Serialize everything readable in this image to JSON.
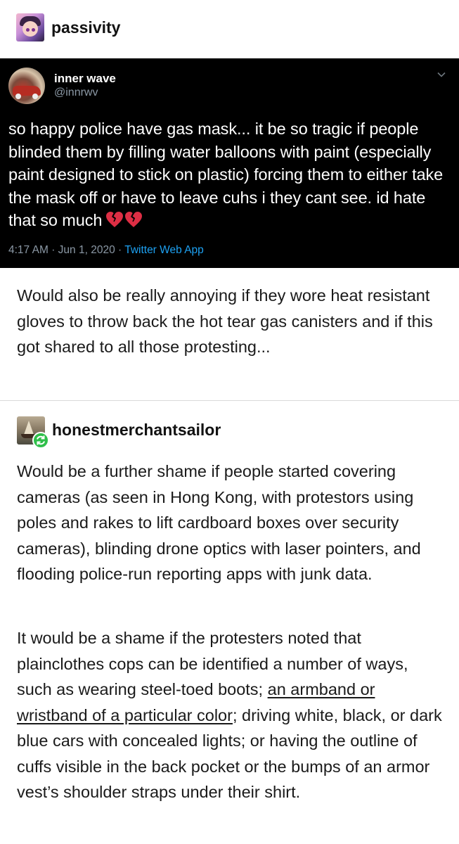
{
  "post": {
    "poster": {
      "username": "passivity",
      "avatar_icon": "anime-avatar-icon"
    },
    "tweet": {
      "display_name": "inner wave",
      "handle": "@innrwv",
      "text": "so happy police have gas mask... it be so tragic if people blinded them by filling water balloons with paint (especially paint designed to stick on plastic) forcing them to either take the mask off or have to leave cuhs i they cant see. id hate that so much",
      "emoji": "broken-heart-icon x2",
      "time": "4:17 AM",
      "date": "Jun 1, 2020",
      "separator": "·",
      "source_app": "Twitter Web App",
      "colors": {
        "background": "#000000",
        "link": "#1da1f2",
        "muted": "#8b98a5"
      }
    },
    "caption": "Would also be really annoying if they wore heat resistant gloves to throw back the hot tear gas canisters and if this got shared to all those protesting..."
  },
  "reblog": {
    "username": "honestmerchantsailor",
    "avatar_icon": "ship-avatar-icon",
    "badge_icon": "reblog-icon",
    "badge_color": "#2fbf4a",
    "paragraph1": "Would be a further shame if people started covering cameras (as seen in Hong Kong, with protestors using poles and rakes to lift cardboard boxes over security cameras), blinding drone optics with laser pointers, and flooding police-run reporting apps with junk data.",
    "paragraph2_before_link": "It would be a shame if the protesters noted that plainclothes cops can be identified a number of ways, such as wearing steel-toed boots; ",
    "paragraph2_link": "an armband or wristband of a particular color",
    "paragraph2_after_link": "; driving white, black, or dark blue cars with concealed lights; or having the outline of cuffs visible in the back pocket or the bumps of an armor vest’s shoulder straps under their shirt."
  }
}
